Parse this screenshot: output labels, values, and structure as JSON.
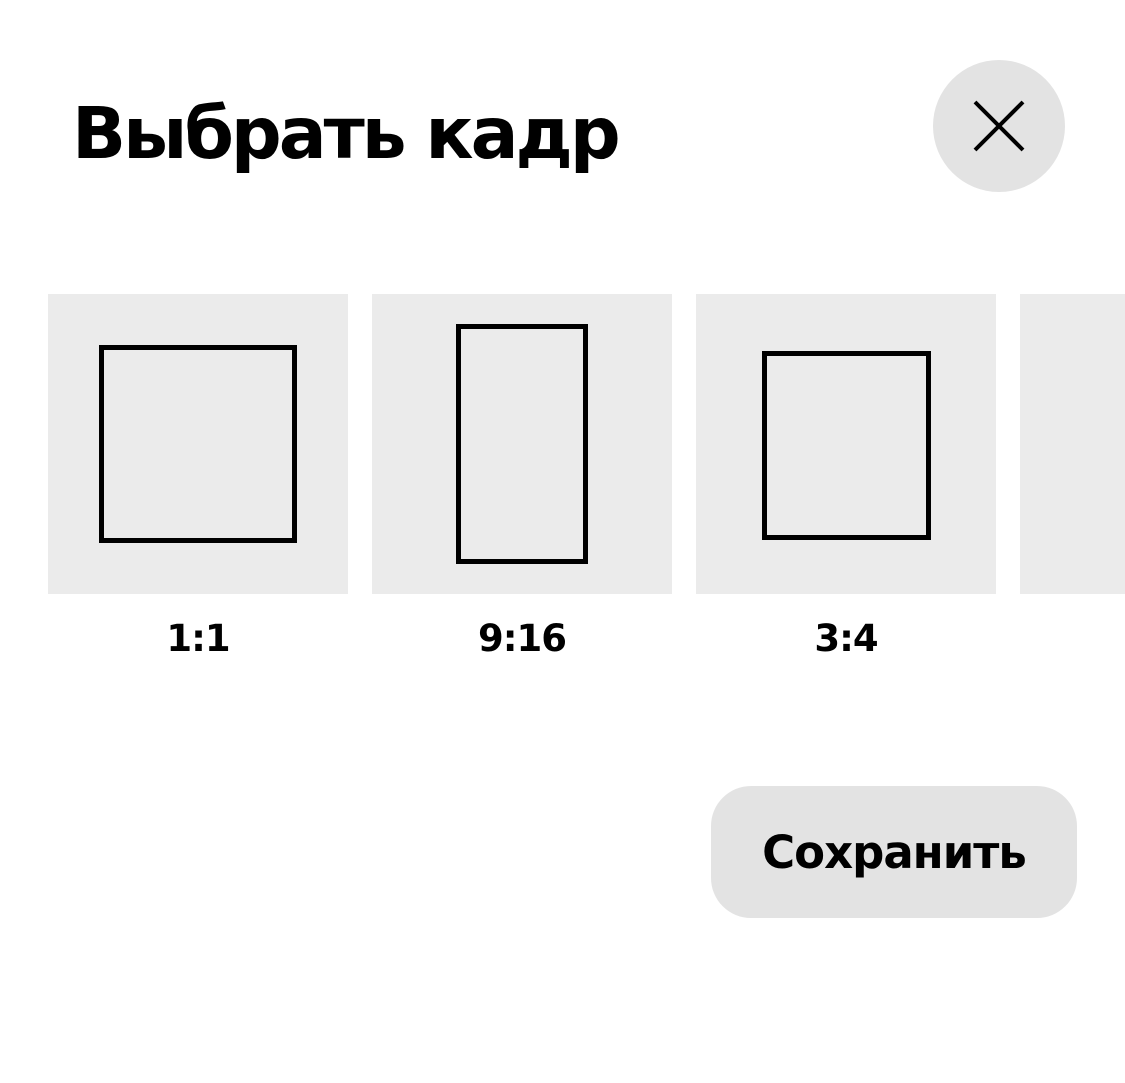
{
  "dialog": {
    "title": "Выбрать кадр",
    "close_icon": "close-icon"
  },
  "frames": [
    {
      "label": "1:1"
    },
    {
      "label": "9:16"
    },
    {
      "label": "3:4"
    }
  ],
  "footer": {
    "save_label": "Сохранить"
  },
  "colors": {
    "tile_background": "#ebebeb",
    "button_background": "#e3e3e3",
    "outline": "#000000"
  }
}
